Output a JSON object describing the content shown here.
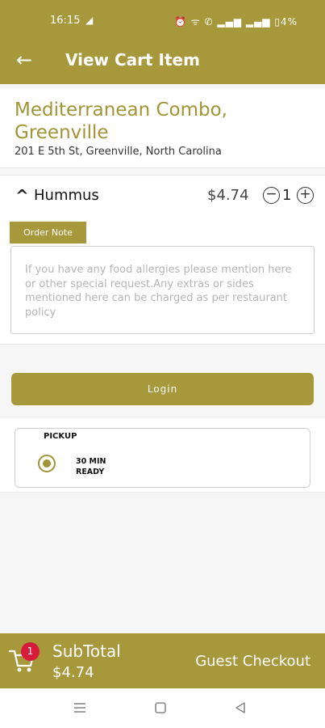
{
  "status_bar": {
    "time": "16:15",
    "telegram_glyph": "◢",
    "right_text": "⏰ ᯤ ✆ ▂▄▆ ▂▄▆ ▯4%"
  },
  "app_bar": {
    "back_glyph": "←",
    "title": "View Cart Item"
  },
  "restaurant": {
    "name": "Mediterranean Combo, Greenville",
    "address": "201 E 5th St, Greenville, North Carolina"
  },
  "cart_item": {
    "collapse_glyph": "^",
    "name": "Hummus",
    "price": "$4.74",
    "quantity": "1",
    "minus_glyph": "−",
    "plus_glyph": "+",
    "order_note_label": "Order Note",
    "order_note_placeholder": "If you have any food allergies please mention here or other special request.Any extras or sides mentioned here can be charged as per restaurant policy"
  },
  "login_button": {
    "label": "Login"
  },
  "pickup": {
    "title": "PICKUP",
    "ready_line1": "30 MIN",
    "ready_line2": "READY",
    "selected": true
  },
  "bottom_bar": {
    "cart_count": "1",
    "subtotal_label": "SubTotal",
    "subtotal_value": "$4.74",
    "checkout_label": "Guest Checkout"
  },
  "nav": {
    "recent": "menu-lines-icon",
    "home": "square-icon",
    "back": "triangle-back-icon"
  },
  "colors": {
    "brand": "#a8983c",
    "brand_text": "#a09536",
    "badge": "#d81b3a"
  }
}
